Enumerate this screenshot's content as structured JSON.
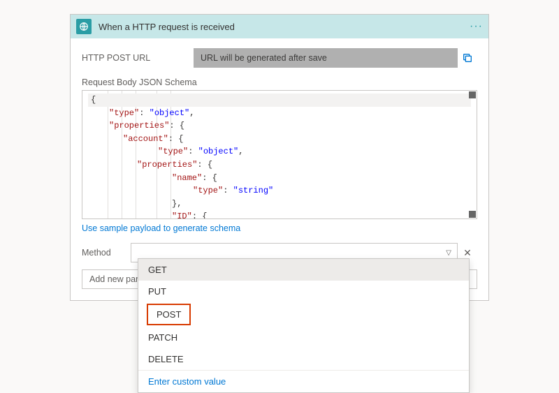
{
  "header": {
    "title": "When a HTTP request is received"
  },
  "url": {
    "label": "HTTP POST URL",
    "value": "URL will be generated after save"
  },
  "schema": {
    "label": "Request Body JSON Schema",
    "lines": {
      "l0": "{",
      "l1a": "\"type\"",
      "l1b": ": ",
      "l1c": "\"object\"",
      "l1d": ",",
      "l2a": "\"properties\"",
      "l2b": ": {",
      "l3a": "\"account\"",
      "l3b": ": {",
      "l4a": "\"type\"",
      "l4b": ": ",
      "l4c": "\"object\"",
      "l4d": ",",
      "l5a": "\"properties\"",
      "l5b": ": {",
      "l6a": "\"name\"",
      "l6b": ": {",
      "l7a": "\"type\"",
      "l7b": ": ",
      "l7c": "\"string\"",
      "l8": "},",
      "l9a": "\"ID\"",
      "l9b": ": {"
    },
    "sample_link": "Use sample payload to generate schema"
  },
  "method": {
    "label": "Method"
  },
  "param": {
    "placeholder": "Add new parameter"
  },
  "dropdown": {
    "options": {
      "get": "GET",
      "put": "PUT",
      "post": "POST",
      "patch": "PATCH",
      "delete": "DELETE"
    },
    "custom": "Enter custom value"
  }
}
